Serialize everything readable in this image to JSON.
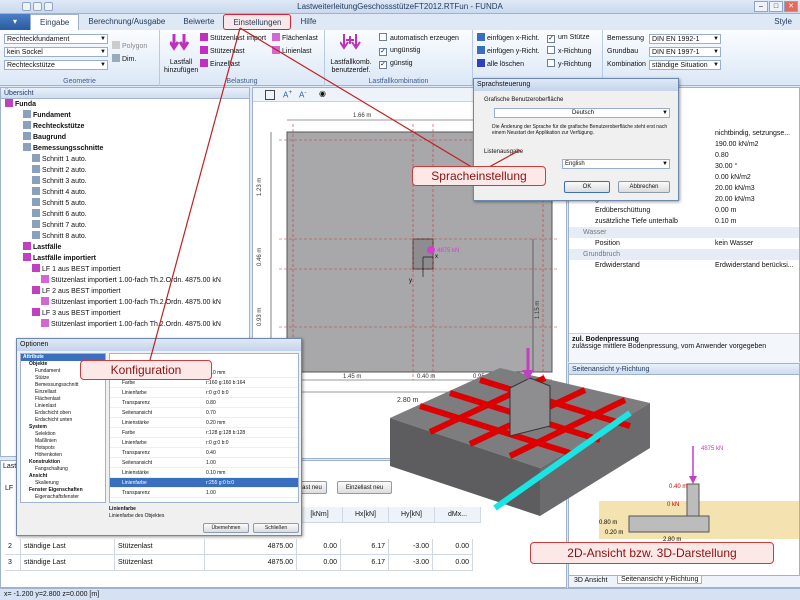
{
  "window": {
    "title": "LastweiterleitungGeschossstützeFT2012.RTFun - FUNDA"
  },
  "app_button": "▾",
  "tabs": [
    "Eingabe",
    "Berechnung/Ausgabe",
    "Beiwerte",
    "Einstellungen",
    "Hilfe"
  ],
  "style_label": "Style",
  "ribbon": {
    "geometrie": {
      "caption": "Geometrie",
      "combo1": "Rechteckfundament",
      "combo2": "kein Sockel",
      "combo3": "Rechteckstütze",
      "polygon": "Polygon",
      "dim": "Dim."
    },
    "belastung": {
      "caption": "Belastung",
      "lastfall": "Lastfall hinzufügen",
      "import": "Stützenlast import",
      "stuetzenlast": "Stützenlast",
      "einzellast": "Einzellast",
      "flaechenlast": "Flächenlast",
      "linienlast": "Linienlast"
    },
    "kombination": {
      "caption": "Lastfallkombination",
      "btn": "Lastfallkomb. benutzerdef.",
      "auto": "automatisch erzeugen",
      "unguenstig": "ungünstig",
      "guenstig": "günstig"
    },
    "einfuegen": {
      "x": "einfügen x-Richt.",
      "y": "einfügen y-Richt.",
      "alle": "alle löschen",
      "stuetze": "um Stütze",
      "xr": "x-Richtung",
      "yr": "y-Richtung"
    },
    "norm": {
      "bem_label": "Bemessung",
      "bem": "DIN EN 1992-1",
      "gr_label": "Grundbau",
      "gr": "DIN EN 1997-1",
      "ko_label": "Kombination",
      "ko": "ständige Situation"
    }
  },
  "overview": {
    "title": "Übersicht",
    "items": [
      "Funda",
      "Fundament",
      "Rechteckstütze",
      "Baugrund",
      "Bemessungsschnitte",
      "Schnitt 1 auto.",
      "Schnitt 2 auto.",
      "Schnitt 3 auto.",
      "Schnitt 4 auto.",
      "Schnitt 5 auto.",
      "Schnitt 6 auto.",
      "Schnitt 7 auto.",
      "Schnitt 8 auto.",
      "Lastfälle",
      "Lastfälle importiert",
      "LF 1 aus BEST importiert",
      "Stützenlast importiert 1.00-fach Th.2.Ordn. 4875.00 kN",
      "LF 2 aus BEST importiert",
      "Stützenlast importiert 1.00-fach Th.2.Ordn. 4875.00 kN",
      "LF 3 aus BEST importiert",
      "Stützenlast importiert 1.00-fach Th.2.Ordn. 4875.00 kN"
    ]
  },
  "drawing": {
    "dim_top": "1.66 m",
    "dim_left1": "1.23 m",
    "dim_left2": "0.46 m",
    "dim_left3": "0.93 m",
    "dim_right": "1.15 m",
    "dim_b1": "1.45 m",
    "dim_b2": "0.40 m",
    "dim_b3": "0.95 m",
    "dim_total": "2.80 m",
    "load": "4875 kN",
    "axis_x": "x",
    "axis_y": "y"
  },
  "props": {
    "rows": [
      [
        "",
        "nichtbindig, setzungse..."
      ],
      [
        "",
        "190.00 kN/m2"
      ],
      [
        "",
        "0.80"
      ],
      [
        "",
        "30.00 °"
      ],
      [
        "",
        "0.00 kN/m2"
      ],
      [
        "gamma oben",
        "20.00 kN/m3"
      ],
      [
        "gamma unten",
        "20.00 kN/m3"
      ],
      [
        "Erdüberschüttung",
        "0.00 m"
      ],
      [
        "zusätzliche Tiefe unterhalb",
        "0.10 m"
      ],
      [
        "Wasser",
        ""
      ],
      [
        "Position",
        "kein Wasser"
      ],
      [
        "Grundbruch",
        ""
      ],
      [
        "Erdwiderstand",
        "Erdwiderstand berücksi..."
      ]
    ],
    "hint_title": "zul. Bodenpressung",
    "hint_text": "zulässige mittlere Bodenpressung, vom Anwender vorgegeben"
  },
  "sprach": {
    "title": "Sprachsteuerung",
    "label1": "Grafische Benutzeroberfläche",
    "value1": "Deutsch",
    "info": "Die Änderung der Sprache für die grafische Benutzeroberfläche steht erst nach einem Neustart der Applikation zur Verfügung.",
    "label2": "Listenausgabe",
    "value2": "English",
    "ok": "OK",
    "cancel": "Abbrechen"
  },
  "optionen": {
    "title": "Optionen",
    "tree": [
      "Attribute",
      "Objekte",
      "Fundament",
      "Stütze",
      "Bemessungsschnitt",
      "Einzellast",
      "Flächenlast",
      "Linienlast",
      "Erdschicht oben",
      "Erdschicht unten",
      "System",
      "Selektion",
      "Maßlinien",
      "Hotspots",
      "Höhenkoten",
      "Konstruktion",
      "Fangschaltung",
      "Ansicht",
      "Skalierung",
      "Fenster Eigenschaften",
      "Eigenschaftsfenster"
    ],
    "rows": [
      [
        "Linienstärke",
        "0.10 mm"
      ],
      [
        "Farbe",
        "r:160 g:160 b:164"
      ],
      [
        "Linienfarbe",
        "r:0 g:0 b:0"
      ],
      [
        "Transparenz",
        "0.80"
      ],
      [
        "Seitenansicht",
        "0.70"
      ],
      [
        "Linienstärke",
        "0.20 mm"
      ],
      [
        "Farbe",
        "r:128 g:128 b:128"
      ],
      [
        "Linienfarbe",
        "r:0 g:0 b:0"
      ],
      [
        "Transparenz",
        "0.40"
      ],
      [
        "Seitenansicht",
        "1.00"
      ],
      [
        "Linienstärke",
        "0.10 mm"
      ],
      [
        "Linienfarbe",
        "r:255 g:0 b:0"
      ],
      [
        "Transparenz",
        "1.00"
      ]
    ],
    "desc_title": "Linienfarbe",
    "desc_text": "Linienfarbe des Objektes",
    "ok": "Übernehmen",
    "cancel": "Schließen"
  },
  "grid": {
    "headers": [
      "[kNm]",
      "Hx[kN]",
      "Hy[kN]",
      "dMx..."
    ],
    "rows": [
      [
        "2",
        "ständige Last",
        "Stützenlast",
        "4875.00",
        "0.00",
        "6.17",
        "-3.00",
        "0.00"
      ],
      [
        "3",
        "ständige Last",
        "Stützenlast",
        "4875.00",
        "0.00",
        "6.17",
        "-3.00",
        "0.00"
      ]
    ],
    "btn1": "ast neu",
    "btn2": "Einzellast neu"
  },
  "side_view": {
    "title": "Seitenansicht y-Richtung",
    "load": "4875 kN",
    "dim1": "0.40 m",
    "dim2": "0 kN",
    "dim3": "0.80 m",
    "dim4": "0.20 m",
    "dim5": "2.80 m",
    "tab1": "3D Ansicht",
    "tab2": "Seitenansicht y-Richtung"
  },
  "callouts": {
    "sprache": "Spracheinstellung",
    "konfig": "Konfiguration",
    "ansicht": "2D-Ansicht  bzw. 3D-Darstellung"
  },
  "statusbar": "x= -1.200   y=2.800   z=0.000 [m]",
  "lf_label": "LF",
  "last_label": "Last"
}
